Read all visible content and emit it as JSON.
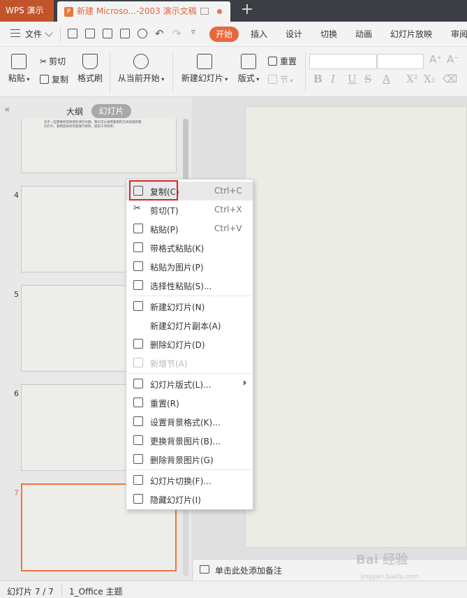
{
  "titlebar": {
    "app_tab": "WPS 演示",
    "doc_title": "新建 Microso...-2003 演示文稿",
    "new_tab": "+"
  },
  "menubar": {
    "file": "文件",
    "tabs": [
      "开始",
      "插入",
      "设计",
      "切换",
      "动画",
      "幻灯片放映",
      "审阅"
    ]
  },
  "ribbon": {
    "paste": "粘贴",
    "cut": "剪切",
    "copy": "复制",
    "format_painter": "格式刷",
    "play_from_start": "从当前开始",
    "new_slide": "新建幻灯片",
    "layout": "版式",
    "reset": "重置",
    "section": "节"
  },
  "left_panel": {
    "tab_outline": "大纲",
    "tab_slides": "幻灯片",
    "slide_numbers": [
      "4",
      "5",
      "6",
      "7"
    ],
    "thumb_text": "对于一些需要经常修改的演示文稿，我们可以采用复制的方式快速新建幻灯片，复制后再对内容进行修改，提高工作效率。"
  },
  "context_menu": {
    "items": [
      {
        "label": "复制(C)",
        "shortcut": "Ctrl+C",
        "icon": "copy-icon"
      },
      {
        "label": "剪切(T)",
        "shortcut": "Ctrl+X",
        "icon": "cut-icon"
      },
      {
        "label": "粘贴(P)",
        "shortcut": "Ctrl+V",
        "icon": "paste-icon"
      },
      {
        "label": "带格式粘贴(K)",
        "icon": "paste-format-icon"
      },
      {
        "label": "粘贴为图片(P)",
        "icon": "paste-image-icon"
      },
      {
        "label": "选择性粘贴(S)...",
        "icon": "paste-special-icon"
      },
      {
        "label": "新建幻灯片(N)",
        "icon": "new-slide-icon"
      },
      {
        "label": "新建幻灯片副本(A)"
      },
      {
        "label": "删除幻灯片(D)",
        "icon": "delete-slide-icon"
      },
      {
        "label": "新增节(A)",
        "icon": "new-section-icon",
        "disabled": true
      },
      {
        "label": "幻灯片版式(L)...",
        "icon": "layout-icon",
        "submenu": true
      },
      {
        "label": "重置(R)",
        "icon": "reset-icon"
      },
      {
        "label": "设置背景格式(K)...",
        "icon": "background-format-icon"
      },
      {
        "label": "更换背景图片(B)...",
        "icon": "change-bg-image-icon"
      },
      {
        "label": "删除背景图片(G)",
        "icon": "delete-bg-image-icon"
      },
      {
        "label": "幻灯片切换(F)...",
        "icon": "transition-icon"
      },
      {
        "label": "隐藏幻灯片(I)",
        "icon": "hide-slide-icon"
      }
    ]
  },
  "notes": {
    "placeholder": "单击此处添加备注"
  },
  "statusbar": {
    "slide_info": "幻灯片 7 / 7",
    "theme": "1_Office 主题"
  },
  "watermark": {
    "main": "Bai 经验",
    "sub": "jingyan.baidu.com"
  },
  "colors": {
    "accent": "#e8683c",
    "app_tab": "#c2542c",
    "highlight_box": "#d4262a",
    "selected_slide_border": "#e8783c"
  }
}
